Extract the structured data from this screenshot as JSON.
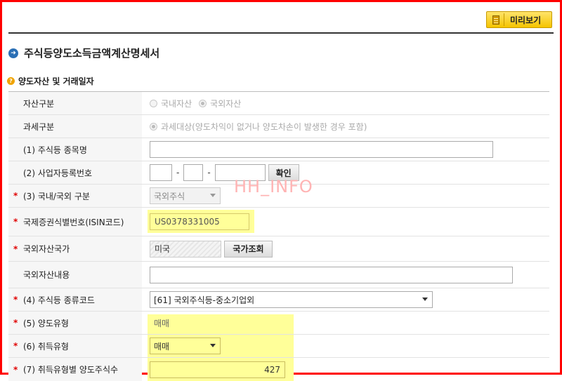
{
  "toolbar": {
    "preview_label": "미리보기"
  },
  "page_title": "주식등양도소득금액계산명세서",
  "section_title": "양도자산 및 거래일자",
  "watermark": "HH_INFO",
  "fields": {
    "asset_type": {
      "label": "자산구분",
      "options": [
        "국내자산",
        "국외자산"
      ],
      "selected": "국외자산"
    },
    "tax_type": {
      "label": "과세구분",
      "option": "과세대상(양도차익이 없거나 양도차손이 발생한 경우 포함)"
    },
    "stock_name": {
      "label": "(1) 주식등 종목명",
      "value": ""
    },
    "biz_reg_no": {
      "label": "(2) 사업자등록번호",
      "part1": "",
      "part2": "",
      "part3": "",
      "confirm_label": "확인"
    },
    "domestic_foreign": {
      "label": "(3) 국내/국외 구분",
      "value": "국외주식"
    },
    "isin": {
      "label": "국제증권식별번호(ISIN코드)",
      "value": "US0378331005"
    },
    "foreign_country": {
      "label": "국외자산국가",
      "value": "미국",
      "lookup_label": "국가조회"
    },
    "foreign_asset_desc": {
      "label": "국외자산내용",
      "value": ""
    },
    "stock_type_code": {
      "label": "(4) 주식등 종류코드",
      "value": "[61] 국외주식등-중소기업외"
    },
    "transfer_type": {
      "label": "(5) 양도유형",
      "value": "매매"
    },
    "acquisition_type": {
      "label": "(6) 취득유형",
      "value": "매매"
    },
    "shares_by_acq_type": {
      "label": "(7) 취득유형별 양도주식수",
      "value": "427"
    }
  },
  "colors": {
    "accent_red": "#e00000",
    "highlight": "#ffff99",
    "preview_button": "#f5c400"
  }
}
